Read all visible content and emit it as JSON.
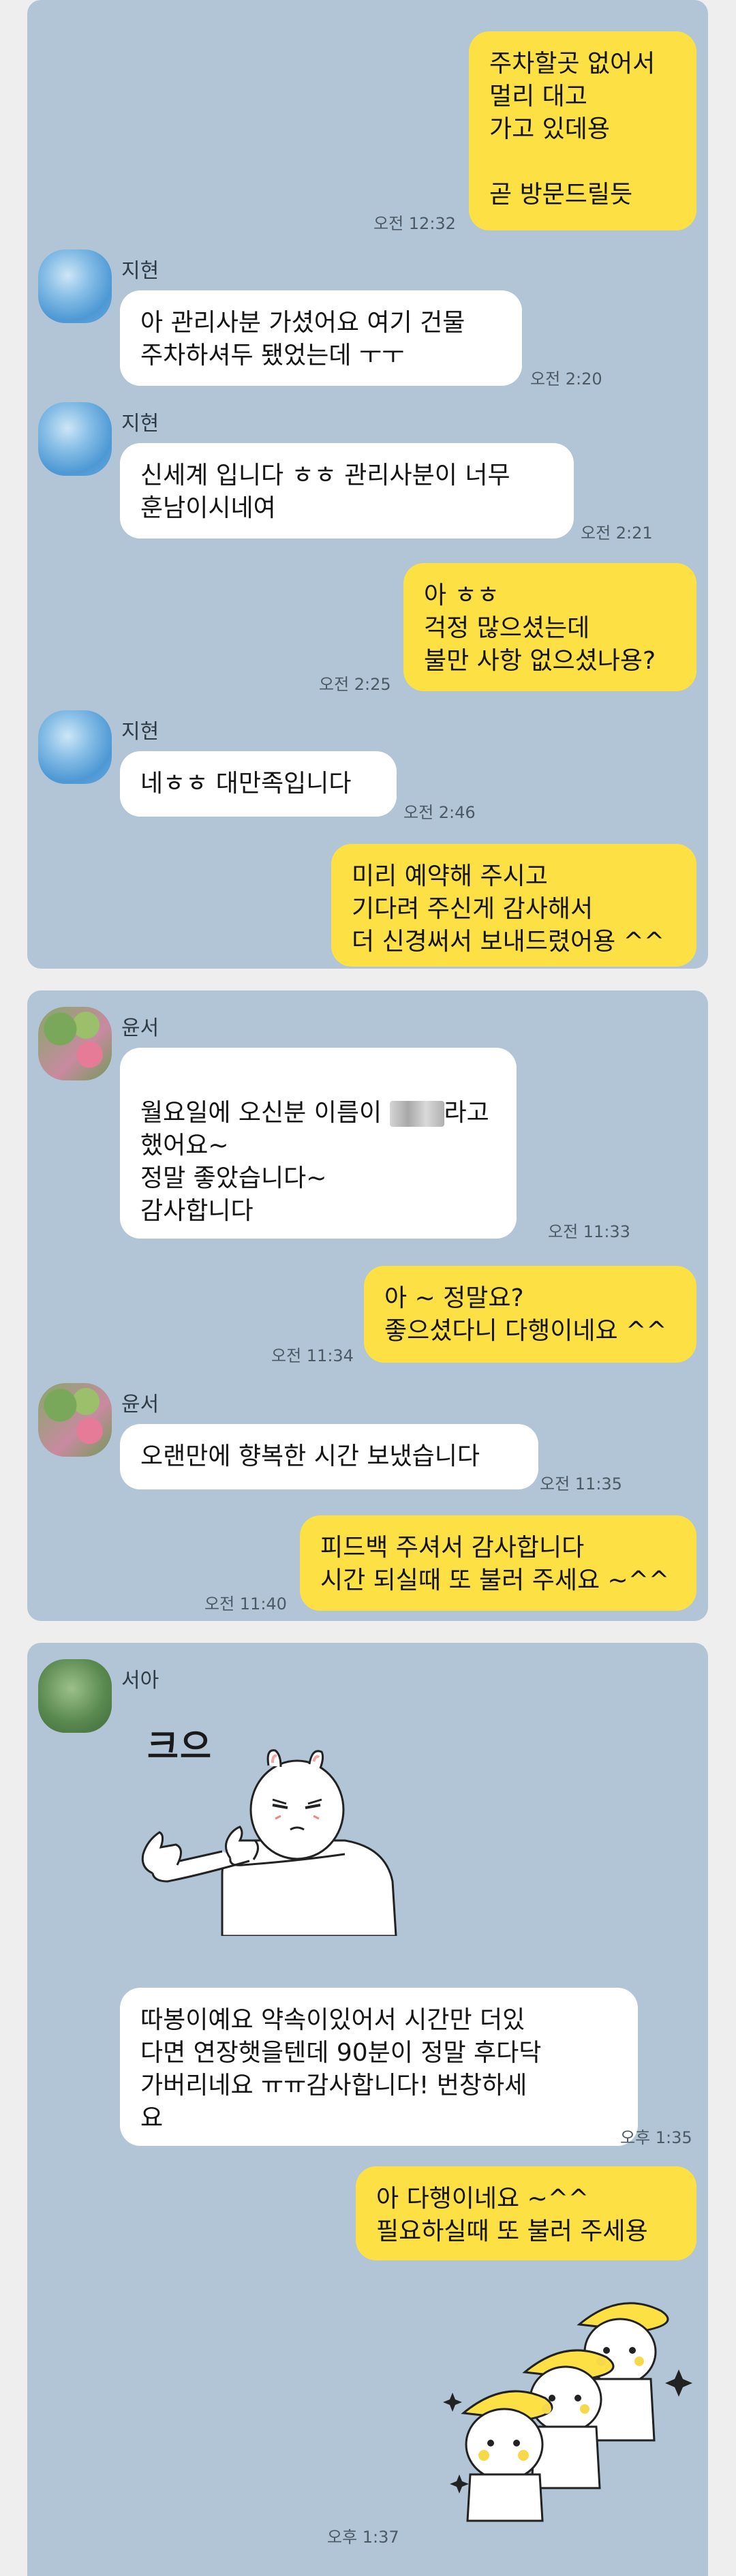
{
  "panel1": {
    "m1": {
      "text": "주차할곳 없어서\n멀리 대고\n가고 있데용\n\n곧 방문드릴듯",
      "time": "오전 12:32"
    },
    "m2": {
      "name": "지현",
      "text": "아 관리사분 가셨어요 여기 건물\n주차하셔두 됐었는데 ㅜㅜ",
      "time": "오전 2:20"
    },
    "m3": {
      "name": "지현",
      "text": "신세계 입니다 ㅎㅎ 관리사분이 너무\n훈남이시네여",
      "time": "오전 2:21"
    },
    "m4": {
      "text": "아 ㅎㅎ\n걱정 많으셨는데\n불만 사항 없으셨나용?",
      "time": "오전 2:25"
    },
    "m5": {
      "name": "지현",
      "text": "네ㅎㅎ 대만족입니다",
      "time": "오전 2:46"
    },
    "m6": {
      "text": "미리 예약해 주시고\n기다려 주신게 감사해서\n더 신경써서 보내드렸어용 ^^"
    }
  },
  "panel2": {
    "m1": {
      "name": "윤서",
      "line1a": "월요일에 오신분 이름이 ",
      "line1b": "라고",
      "rest": "했어요~\n정말 좋았습니다~\n감사합니다",
      "time": "오전 11:33"
    },
    "m2": {
      "text": "아 ~ 정말요?\n좋으셨다니 다행이네요 ^^",
      "time": "오전 11:34"
    },
    "m3": {
      "name": "윤서",
      "text": "오랜만에 향복한 시간 보냈습니다",
      "time": "오전 11:35"
    },
    "m4": {
      "text": "피드백 주셔서 감사합니다\n시간 되실때 또 불러 주세요 ~^^",
      "time": "오전 11:40"
    }
  },
  "panel3": {
    "m1": {
      "name": "서아",
      "sticker_text": "크으"
    },
    "m2": {
      "text": "따봉이예요 약속이있어서 시간만 더있\n다면 연장햇을텐데 90분이 정말 후다닥\n가버리네요 ㅠㅠ감사합니다! 번창하세\n요",
      "time": "오후 1:35"
    },
    "m3": {
      "text": "아 다행이네요 ~^^\n필요하실때 또 불러 주세용"
    },
    "m4": {
      "time": "오후 1:37"
    }
  }
}
